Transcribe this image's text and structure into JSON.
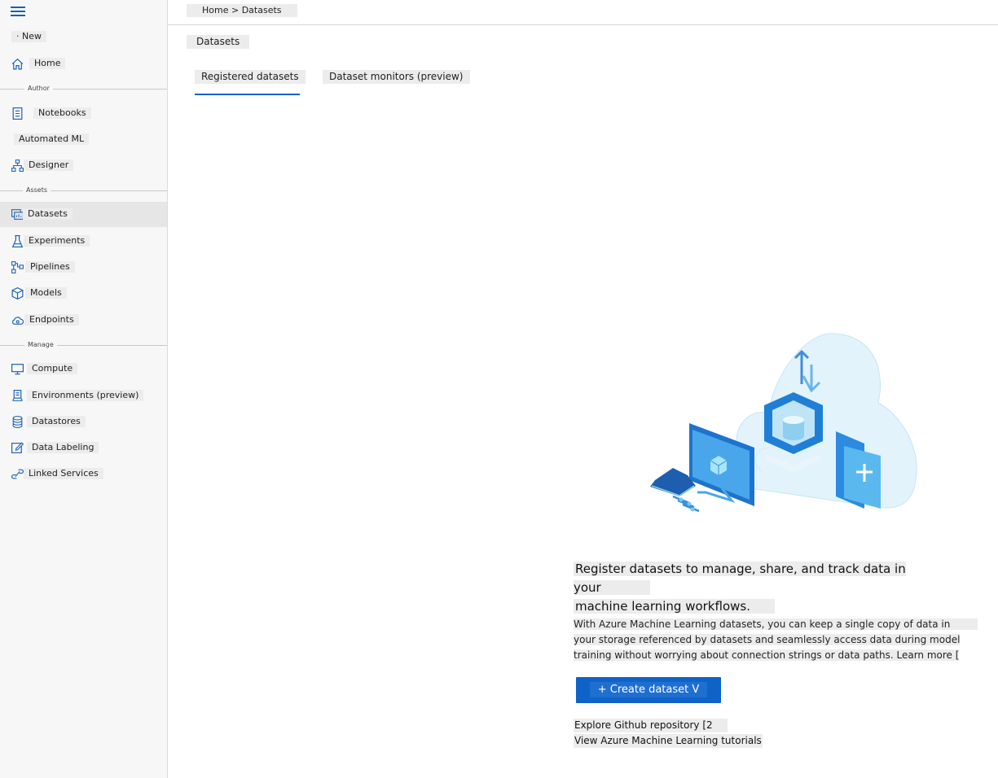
{
  "sidebar": {
    "new_label": "· New",
    "home_label": "Home",
    "sections": {
      "author": "Author",
      "assets": "Assets",
      "manage": "Manage"
    },
    "items": {
      "notebooks": "Notebooks",
      "automated_ml": "Automated ML",
      "designer": "Designer",
      "datasets": "Datasets",
      "experiments": "Experiments",
      "pipelines": "Pipelines",
      "models": "Models",
      "endpoints": "Endpoints",
      "compute": "Compute",
      "environments": "Environments (preview)",
      "datastores": "Datastores",
      "data_labeling": "Data Labeling",
      "linked_services": "Linked Services"
    },
    "active_item": "Datasets"
  },
  "header": {
    "breadcrumb": "Home > Datasets",
    "page_title": "Datasets"
  },
  "tabs": {
    "registered": "Registered datasets",
    "monitors": "Dataset monitors (preview)",
    "selected": "Registered datasets"
  },
  "empty_state": {
    "headline_line1": "Register datasets to manage, share, and track data in your",
    "headline_line2": "machine learning workflows.",
    "desc_line1": "With Azure Machine Learning datasets, you can keep a single copy of data in",
    "desc_line2": "your storage referenced by datasets and seamlessly access data during model",
    "desc_line3": "training without worrying about connection strings or data paths. Learn more [",
    "create_button": "+ Create dataset V",
    "github_link": "Explore Github repository [2",
    "tutorials_link": "View Azure Machine Learning tutorials"
  },
  "colors": {
    "accent": "#0f62c8",
    "sidebar_bg": "#f7f7f7",
    "active_bg": "#e6e6e6"
  }
}
